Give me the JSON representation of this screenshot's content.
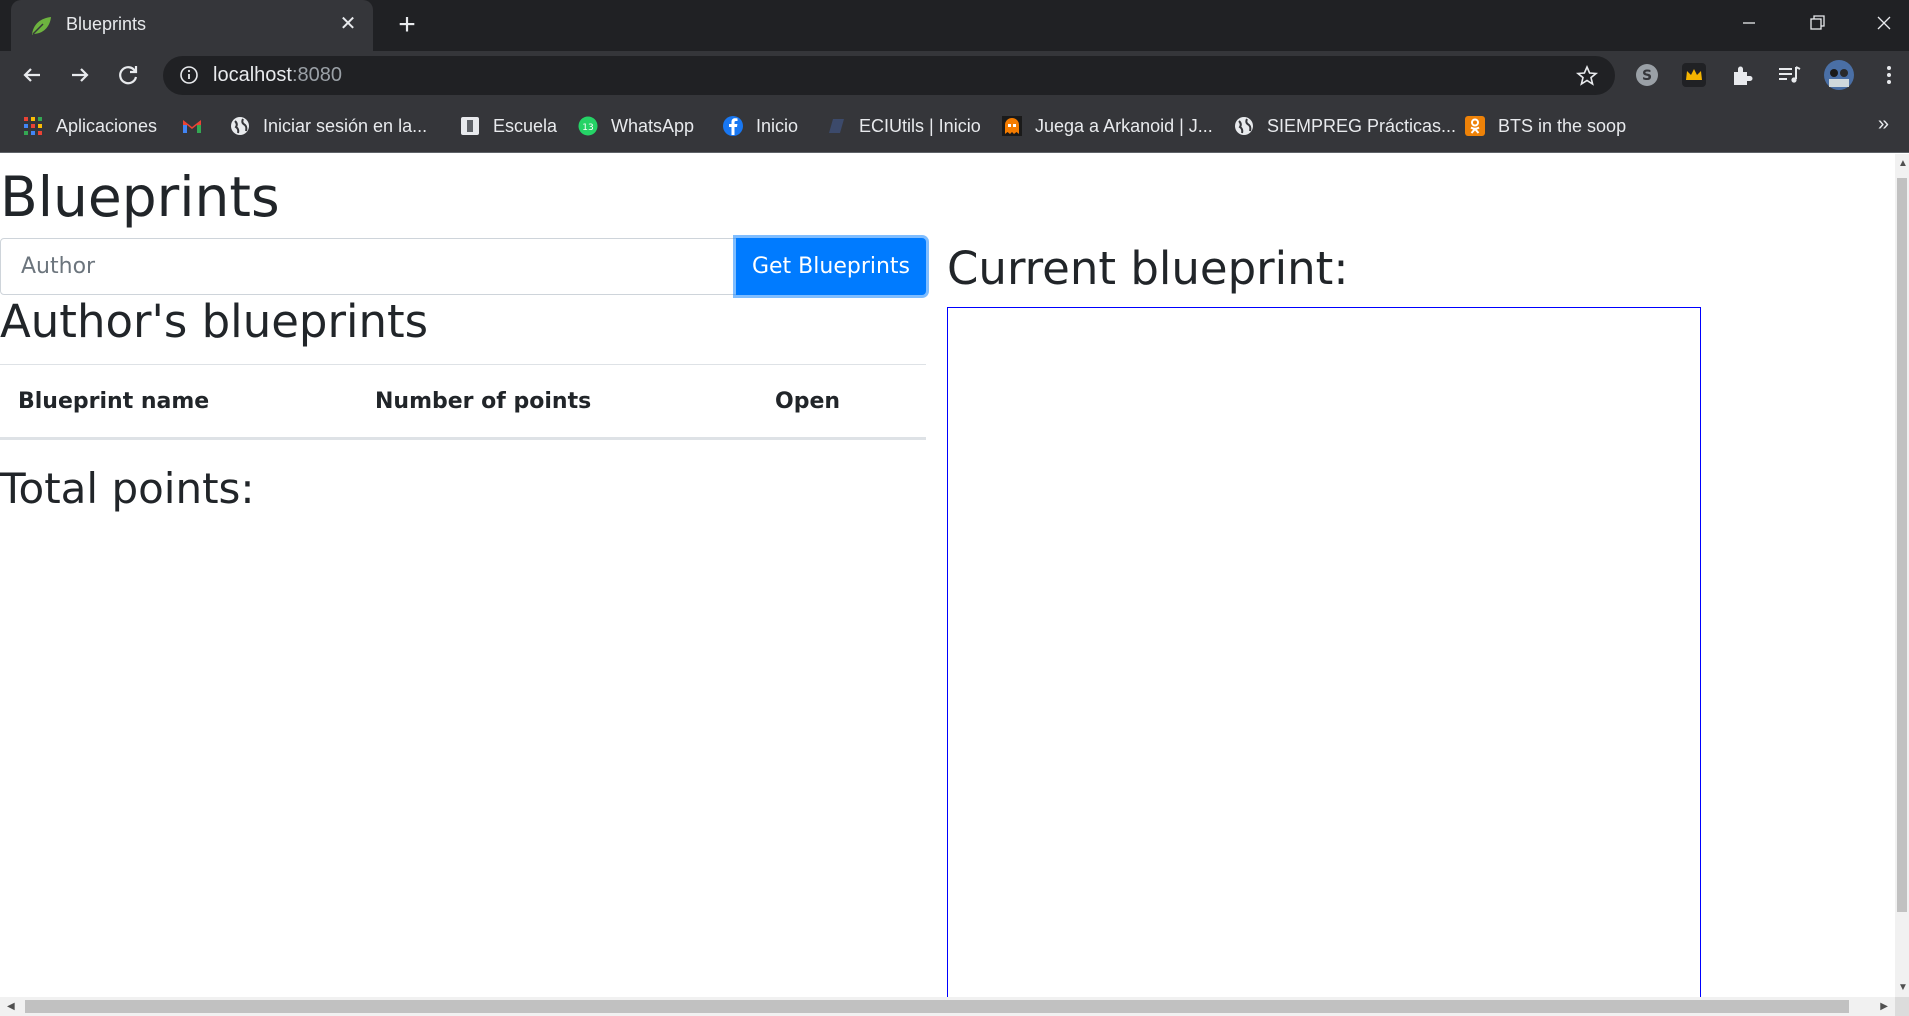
{
  "browser": {
    "tab_title": "Blueprints",
    "url_host": "localhost",
    "url_port": ":8080",
    "bookmarks": [
      {
        "label": "Aplicaciones",
        "icon": "apps-grid-icon"
      },
      {
        "label": "",
        "icon": "gmail-icon"
      },
      {
        "label": "Iniciar sesión en la...",
        "icon": "globe-icon"
      },
      {
        "label": "Escuela",
        "icon": "school-icon"
      },
      {
        "label": "WhatsApp",
        "icon": "whatsapp-icon"
      },
      {
        "label": "Inicio",
        "icon": "facebook-icon"
      },
      {
        "label": "ECIUtils | Inicio",
        "icon": "book-icon"
      },
      {
        "label": "Juega a Arkanoid | J...",
        "icon": "pacman-ghost-icon"
      },
      {
        "label": "SIEMPREG Prácticas...",
        "icon": "globe-icon"
      },
      {
        "label": "BTS in the soop",
        "icon": "ok-icon"
      }
    ],
    "more_bookmarks": "»"
  },
  "page": {
    "title": "Blueprints",
    "author_placeholder": "Author",
    "get_button": "Get Blueprints",
    "authors_title": "Author's blueprints",
    "table_headers": [
      "Blueprint name",
      "Number of points",
      "Open"
    ],
    "total_points": "Total points:",
    "current_title": "Current blueprint:"
  },
  "colors": {
    "primary_button": "#007bff",
    "canvas_border": "#0000ff",
    "chrome_dark": "#202124",
    "chrome_toolbar": "#35363a"
  }
}
